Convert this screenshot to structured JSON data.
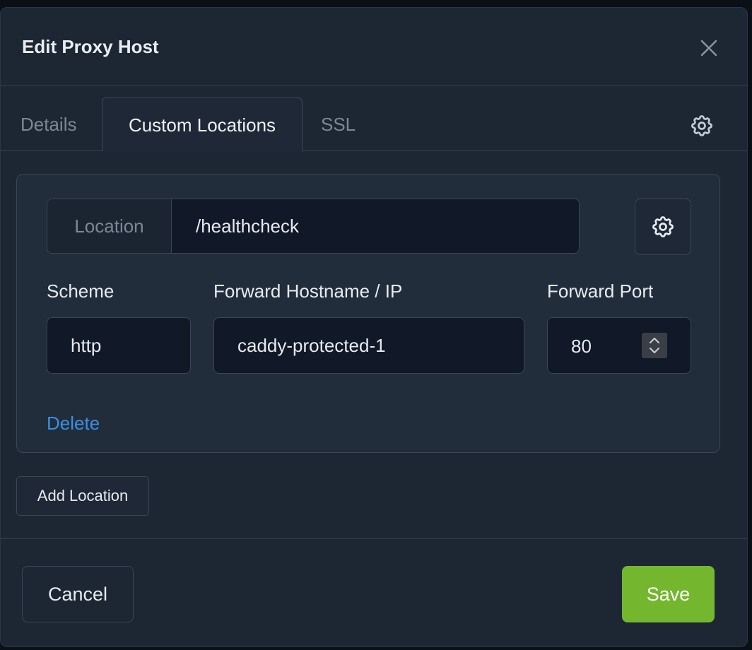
{
  "modal": {
    "title": "Edit Proxy Host"
  },
  "tabs": [
    {
      "label": "Details",
      "active": false
    },
    {
      "label": "Custom Locations",
      "active": true
    },
    {
      "label": "SSL",
      "active": false
    }
  ],
  "location": {
    "addon_label": "Location",
    "value": "/healthcheck"
  },
  "fields": {
    "scheme": {
      "label": "Scheme",
      "value": "http"
    },
    "hostname": {
      "label": "Forward Hostname / IP",
      "value": "caddy-protected-1"
    },
    "port": {
      "label": "Forward Port",
      "value": "80"
    }
  },
  "actions": {
    "delete_label": "Delete",
    "add_location_label": "Add Location",
    "cancel_label": "Cancel",
    "save_label": "Save"
  },
  "icons": {
    "close": "close-icon",
    "settings": "gear-icon",
    "spinner": "chevron-up-down-icon"
  },
  "colors": {
    "accent_link": "#3b8ee0",
    "save_green": "#74b72e",
    "modal_bg": "#1d2633",
    "card_bg": "#222d3b"
  }
}
